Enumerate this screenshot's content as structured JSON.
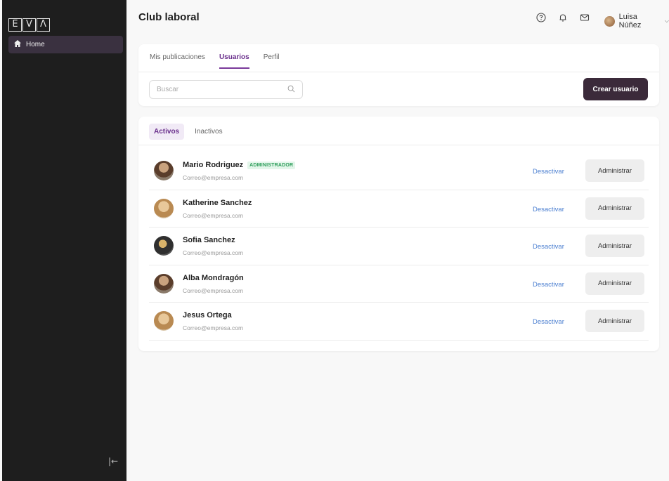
{
  "app": {
    "logo_letters": [
      "E",
      "V",
      "Λ"
    ],
    "page_title": "Club laboral",
    "accent_color": "#6a2f8c",
    "primary_button_color": "#3b2a3a"
  },
  "sidebar": {
    "items": [
      {
        "label": "Home",
        "icon": "home-icon"
      }
    ],
    "collapse_glyph": "|←"
  },
  "header": {
    "icons": [
      "help-icon",
      "bell-icon",
      "mail-icon"
    ],
    "user_name": "Luisa Núñez"
  },
  "tabs": [
    {
      "label": "Mis publicaciones",
      "active": false
    },
    {
      "label": "Usuarios",
      "active": true
    },
    {
      "label": "Perfil",
      "active": false
    }
  ],
  "search": {
    "placeholder": "Buscar",
    "value": ""
  },
  "create_button_label": "Crear usuario",
  "subtabs": [
    {
      "label": "Activos",
      "active": true
    },
    {
      "label": "Inactivos",
      "active": false
    }
  ],
  "users": [
    {
      "name": "Mario Rodriguez",
      "email": "Correo@empresa.com",
      "badge": "ADMINISTRADOR",
      "deactivate_label": "Desactivar",
      "manage_label": "Administrar"
    },
    {
      "name": "Katherine Sanchez",
      "email": "Correo@empresa.com",
      "badge": "",
      "deactivate_label": "Desactivar",
      "manage_label": "Administrar"
    },
    {
      "name": "Sofia Sanchez",
      "email": "Correo@empresa.com",
      "badge": "",
      "deactivate_label": "Desactivar",
      "manage_label": "Administrar"
    },
    {
      "name": "Alba Mondragón",
      "email": "Correo@empresa.com",
      "badge": "",
      "deactivate_label": "Desactivar",
      "manage_label": "Administrar"
    },
    {
      "name": "Jesus Ortega",
      "email": "Correo@empresa.com",
      "badge": "",
      "deactivate_label": "Desactivar",
      "manage_label": "Administrar"
    }
  ]
}
